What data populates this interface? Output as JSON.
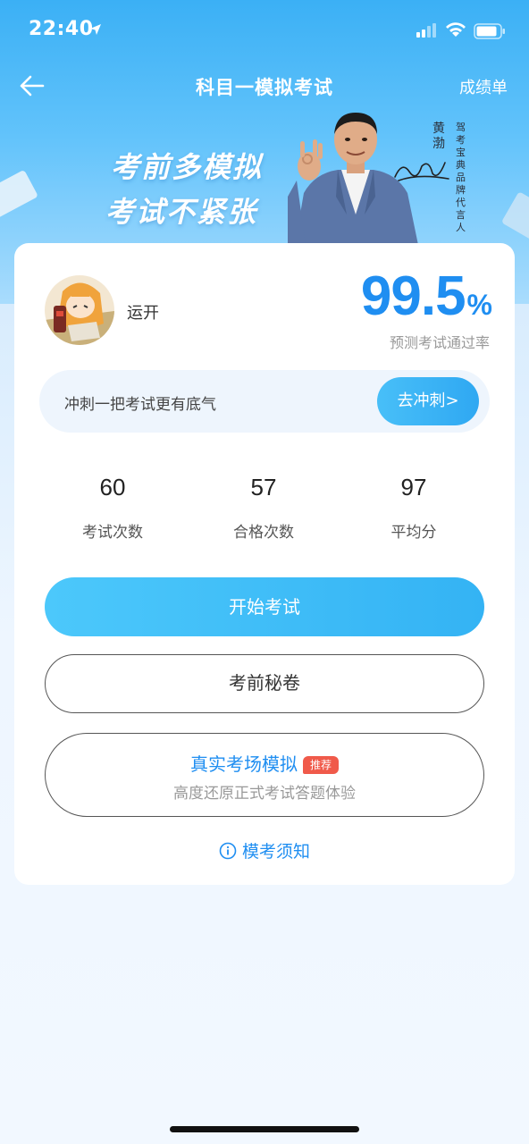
{
  "status_bar": {
    "time": "22:40"
  },
  "nav": {
    "title": "科目一模拟考试",
    "right_label": "成绩单"
  },
  "banner": {
    "slogan_line1": "考前多模拟",
    "slogan_line2": "考试不紧张",
    "endorser_name": "黄渤",
    "endorser_title": "驾考宝典品牌代言人"
  },
  "profile": {
    "username": "运开",
    "pass_rate": "99.5",
    "pass_rate_unit": "%",
    "pass_rate_label": "预测考试通过率"
  },
  "sprint": {
    "text": "冲刺一把考试更有底气",
    "button_label": "去冲刺>"
  },
  "stats": [
    {
      "value": "60",
      "label": "考试次数"
    },
    {
      "value": "57",
      "label": "合格次数"
    },
    {
      "value": "97",
      "label": "平均分"
    }
  ],
  "actions": {
    "start_label": "开始考试",
    "secret_label": "考前秘卷",
    "real_title": "真实考场模拟",
    "real_badge": "推荐",
    "real_subtitle": "高度还原正式考试答题体验"
  },
  "notice_label": "模考须知",
  "colors": {
    "accent": "#1f8ef1",
    "button_gradient_start": "#4cc8fb",
    "badge": "#f05a4a"
  }
}
